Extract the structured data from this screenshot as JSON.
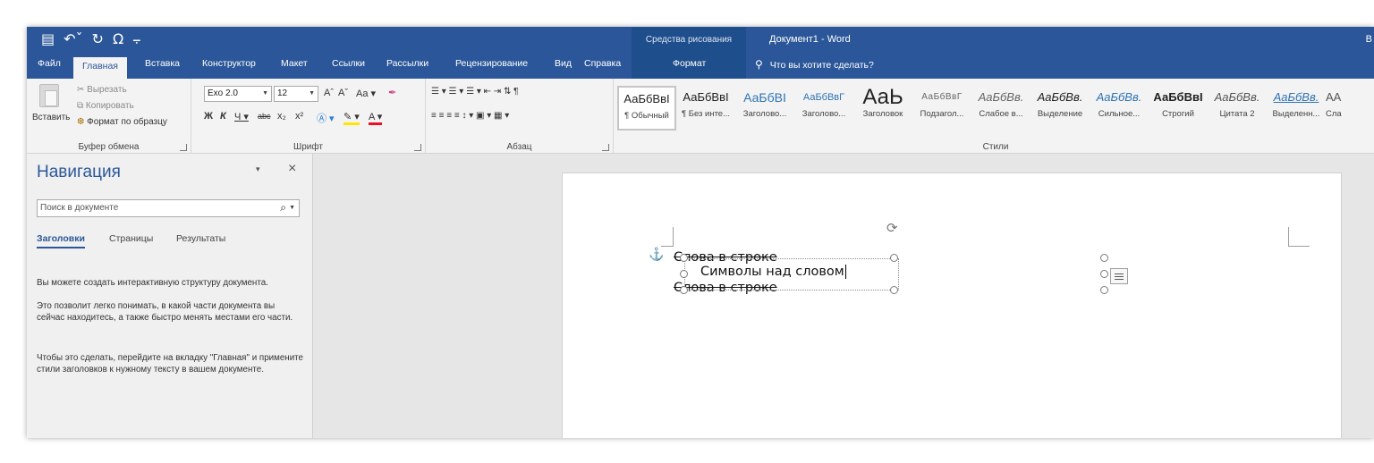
{
  "titlebar": {
    "qat_icons": [
      "save-icon",
      "undo-icon",
      "redo-icon",
      "omega-icon",
      "customize-icon"
    ],
    "qat_glyphs": [
      "▤",
      "↶ˇ",
      "↻",
      "Ω",
      "⨪"
    ],
    "context_group": "Средства рисования",
    "doc_title": "Документ1 - Word",
    "user_initial": "В"
  },
  "tabs": [
    {
      "label": "Файл"
    },
    {
      "label": "Главная",
      "active": true
    },
    {
      "label": "Вставка"
    },
    {
      "label": "Конструктор"
    },
    {
      "label": "Макет"
    },
    {
      "label": "Ссылки"
    },
    {
      "label": "Рассылки"
    },
    {
      "label": "Рецензирование"
    },
    {
      "label": "Вид"
    },
    {
      "label": "Справка"
    }
  ],
  "context_tab": "Формат",
  "tellme": "Что вы хотите сделать?",
  "ribbon": {
    "clipboard": {
      "paste": "Вставить",
      "cut": "Вырезать",
      "copy": "Копировать",
      "format_painter": "Формат по образцу",
      "label": "Буфер обмена"
    },
    "font": {
      "name": "Exo 2.0",
      "size": "12",
      "grow": "Aˆ",
      "shrink": "Aˇ",
      "case": "Aa ▾",
      "clear": "✒",
      "bold": "Ж",
      "italic": "К",
      "underline": "Ч ▾",
      "strike": "abc",
      "sub": "x₂",
      "sup": "x²",
      "effects": "Ⓐ ▾",
      "highlight": "✎ ▾",
      "color": "A ▾",
      "label": "Шрифт"
    },
    "paragraph": {
      "row1": "☰ ▾  ☰ ▾  ☰ ▾   ⇤ ⇥   ⇅   ¶",
      "row2": "≡  ≡  ≡  ≡   ↕ ▾   ▣ ▾  ▦ ▾",
      "label": "Абзац"
    },
    "styles": {
      "label": "Стили",
      "items": [
        {
          "preview": "АаБбВвІ",
          "name": "¶ Обычный"
        },
        {
          "preview": "АаБбВвІ",
          "name": "¶ Без инте..."
        },
        {
          "preview": "АаБбВІ",
          "name": "Заголово..."
        },
        {
          "preview": "АаБбВвГ",
          "name": "Заголово..."
        },
        {
          "preview": "АаЬ",
          "name": "Заголовок"
        },
        {
          "preview": "АаБбВвГ",
          "name": "Подзагол..."
        },
        {
          "preview": "АаБбВв.",
          "name": "Слабое в..."
        },
        {
          "preview": "АаБбВв.",
          "name": "Выделение"
        },
        {
          "preview": "АаБбВв.",
          "name": "Сильное..."
        },
        {
          "preview": "АаБбВвІ",
          "name": "Строгий"
        },
        {
          "preview": "АаБбВв.",
          "name": "Цитата 2"
        },
        {
          "preview": "АаБбВв.",
          "name": "Выделенн..."
        },
        {
          "preview": "АА",
          "name": "Сла"
        }
      ]
    }
  },
  "nav": {
    "title": "Навигация",
    "pin": "▾",
    "close": "×",
    "search_placeholder": "Поиск в документе",
    "search_icon": "⌕",
    "tabs": [
      "Заголовки",
      "Страницы",
      "Результаты"
    ],
    "text1": "Вы можете создать интерактивную структуру документа.",
    "text2": "Это позволит легко понимать, в какой части документа вы сейчас находитесь, а также быстро менять местами его части.",
    "text3": "Чтобы это сделать, перейдите на вкладку \"Главная\" и примените стили заголовков к нужному тексту в вашем документе."
  },
  "document": {
    "line1": "Слова в строке",
    "line2": "Символы над словом",
    "line3": "Слова в строке",
    "anchor_icon": "⚓",
    "rotate_icon": "⟳"
  }
}
